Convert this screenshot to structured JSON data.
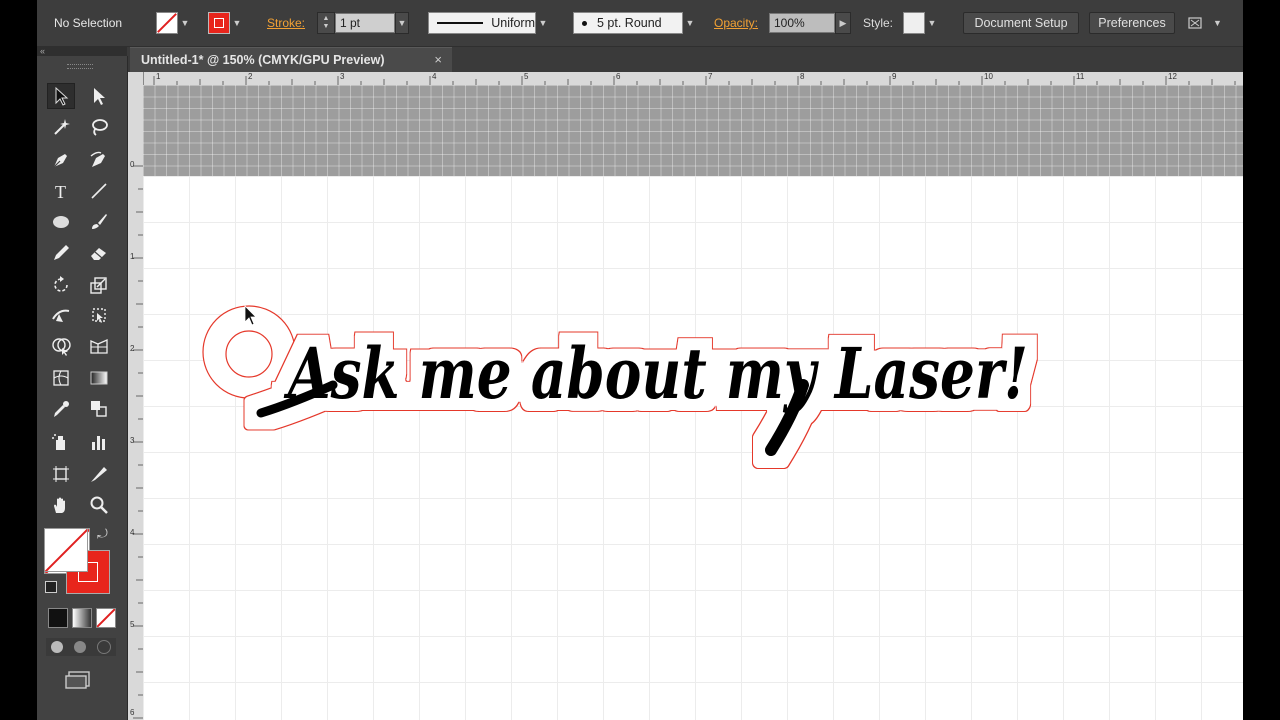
{
  "control_bar": {
    "selection_status": "No Selection",
    "stroke_label": "Stroke:",
    "stroke_weight": "1 pt",
    "variable_width_profile": "Uniform",
    "brush_definition": "5 pt. Round",
    "opacity_label": "Opacity:",
    "opacity_value": "100%",
    "style_label": "Style:",
    "document_setup_label": "Document Setup",
    "preferences_label": "Preferences"
  },
  "document": {
    "tab_title": "Untitled-1* @ 150% (CMYK/GPU Preview)",
    "tab_close": "×"
  },
  "panel": {
    "collapse_glyph": "«"
  },
  "ruler": {
    "top_numbers": [
      "1",
      "2",
      "3",
      "4",
      "5",
      "6",
      "7",
      "8",
      "9",
      "10",
      "11",
      "12"
    ],
    "left_numbers": [
      "0",
      "1",
      "2",
      "3",
      "4",
      "5",
      "6"
    ]
  },
  "artwork": {
    "text": "Ask me about my Laser!",
    "text_color": "#000000",
    "cut_outline_color": "#e5392b"
  },
  "colors": {
    "fill": "none",
    "stroke": "#e8251c"
  }
}
